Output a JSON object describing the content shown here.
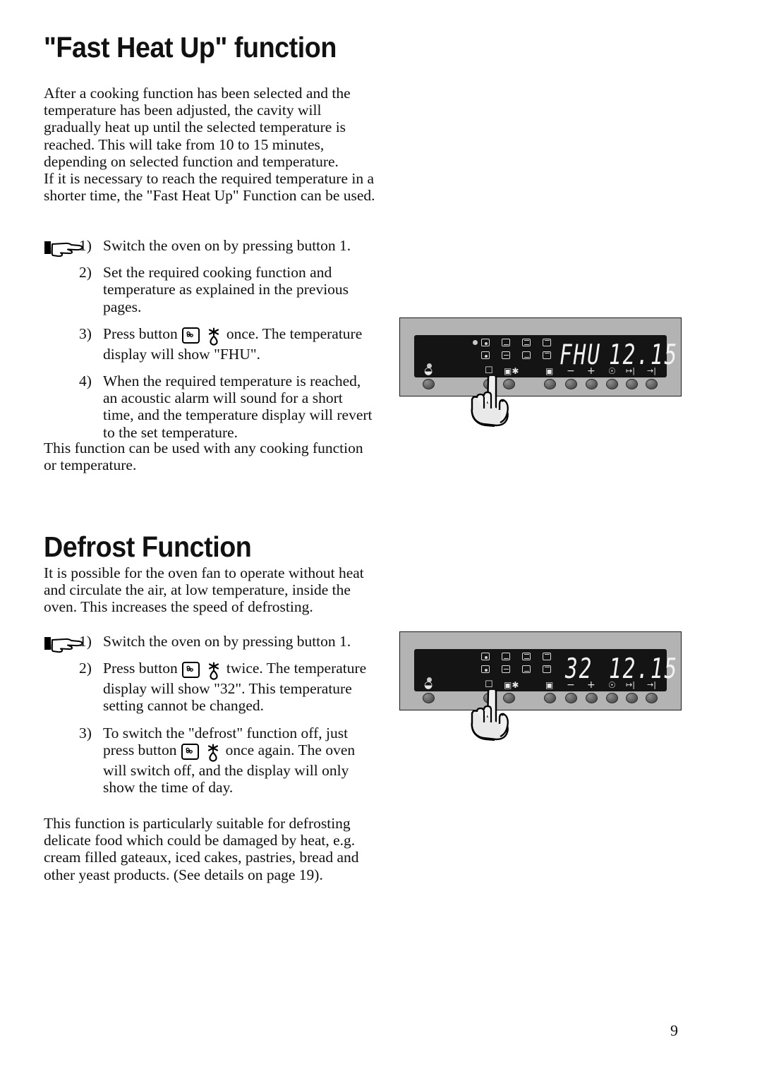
{
  "page": {
    "number": "9"
  },
  "sections": [
    {
      "title": "\"Fast Heat Up\" function",
      "intro": "After a cooking function has been selected and the temperature has been adjusted, the cavity will gradually heat up until the selected temperature is reached. This will take from 10 to 15 minutes, depending on selected function and temperature.",
      "intro2": "If it is necessary to reach the required temperature in a shorter time, the \"Fast Heat Up\" Function can be used.",
      "steps": [
        {
          "num": "1)",
          "text": "Switch the oven on by pressing button 1."
        },
        {
          "num": "2)",
          "text": "Set the required cooking function and temperature as explained in the previous pages."
        },
        {
          "num": "3)",
          "pre": "Press button",
          "icons": true,
          "post": "once. The temperature display will show \"FHU\"."
        },
        {
          "num": "4)",
          "text": "When the required temperature is reached, an acoustic alarm will sound for a short time, and the temperature display will revert to the set temperature."
        }
      ],
      "closing": "This function can be used with any cooking function or temperature."
    },
    {
      "title": "Defrost Function",
      "intro": "It is possible for the oven fan to operate without heat and circulate the air, at low temperature, inside the oven. This increases the speed of defrosting.",
      "steps": [
        {
          "num": "1)",
          "text": "Switch the oven on by pressing button 1."
        },
        {
          "num": "2)",
          "pre": "Press button",
          "icons": true,
          "post": "twice. The temperature display will show \"32\". This temperature setting cannot be changed."
        },
        {
          "num": "3)",
          "pre": "To switch the \"defrost\" function off, just press button",
          "icons": true,
          "post": "once again. The oven will switch off, and the display will only show the time of day."
        }
      ],
      "closing": "This function is particularly suitable for defrosting delicate food which could be damaged by heat, e.g. cream filled gateaux, iced cakes, pastries, bread and other yeast products. (See details on page 19)."
    }
  ],
  "figures": [
    {
      "name": "oven-control-panel-fhu",
      "display": {
        "temperature": "FHU",
        "clock": "12.15"
      },
      "symbols": [
        "power-icon",
        "square-icon",
        "fan-defrost-icon",
        "meat-probe-icon",
        "minus-icon",
        "plus-icon",
        "clock-icon",
        "duration-icon",
        "end-time-icon"
      ],
      "button_count": 9,
      "active_indicator": true
    },
    {
      "name": "oven-control-panel-defrost",
      "display": {
        "temperature": "32",
        "clock": "12.15"
      },
      "symbols": [
        "power-icon",
        "square-icon",
        "fan-defrost-icon",
        "meat-probe-icon",
        "minus-icon",
        "plus-icon",
        "clock-icon",
        "duration-icon",
        "end-time-icon"
      ],
      "button_count": 9,
      "active_indicator": false
    }
  ],
  "colors": {
    "panel_body": "#b3b3b3",
    "panel_screen": "#141414",
    "display_text": "#f2f2f2",
    "text": "#101010"
  }
}
